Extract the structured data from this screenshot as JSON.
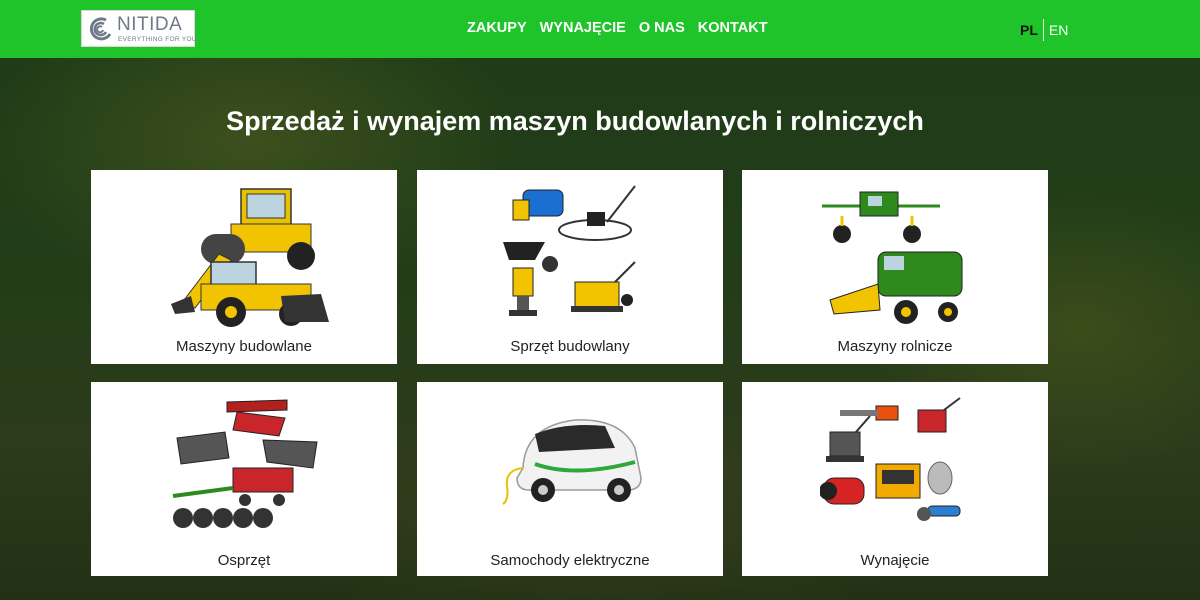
{
  "header": {
    "logo": {
      "name": "NITIDA",
      "tagline": "EVERYTHING FOR YOU"
    },
    "nav": [
      {
        "label": "ZAKUPY"
      },
      {
        "label": "WYNAJĘCIE"
      },
      {
        "label": "O NAS"
      },
      {
        "label": "KONTAKT"
      }
    ],
    "languages": {
      "active": "PL",
      "other": "EN"
    }
  },
  "hero": {
    "title": "Sprzedaż i wynajem maszyn budowlanych i rolniczych"
  },
  "categories": [
    {
      "label": "Maszyny budowlane",
      "icon": "construction-machinery-image"
    },
    {
      "label": "Sprzęt budowlany",
      "icon": "construction-equipment-image"
    },
    {
      "label": "Maszyny rolnicze",
      "icon": "agricultural-machinery-image"
    },
    {
      "label": "Osprzęt",
      "icon": "attachments-image"
    },
    {
      "label": "Samochody elektryczne",
      "icon": "electric-car-image"
    },
    {
      "label": "Wynajęcie",
      "icon": "rental-equipment-image"
    }
  ],
  "colors": {
    "header_green": "#1fc42a",
    "card_bg": "#ffffff",
    "machine_yellow": "#f2c300",
    "machine_green": "#2f8a1e"
  }
}
